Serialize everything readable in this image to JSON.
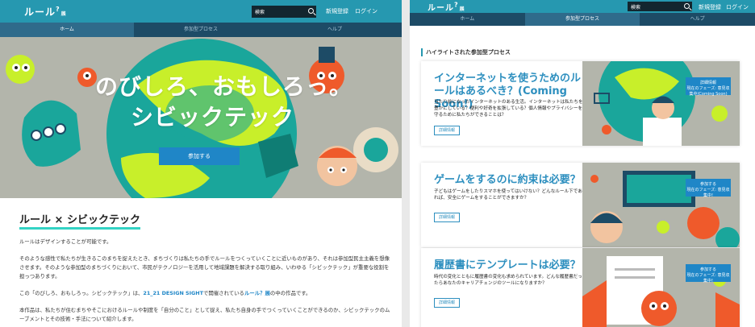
{
  "header": {
    "logo": "ルール",
    "logo_sup": "?",
    "logo_small": "展",
    "search_placeholder": "検索",
    "register": "新規登録",
    "login": "ログイン"
  },
  "nav": {
    "tabs": [
      "ホーム",
      "参加型プロセス",
      "ヘルプ"
    ]
  },
  "hero": {
    "title_line1": "のびしろ、おもしろっ。",
    "title_line2": "シビックテック",
    "cta": "参加する"
  },
  "intro": {
    "heading": "ルール × シビックテック",
    "p1": "ルールはデザインすることが可能です。",
    "p2": "そのような感性で私たちが生きるこのまちを捉えたとき、まちづくりは私たちの手でルールをつくっていくことに近いものがあり、それは参加型民主主義を想像させます。そのような参加型のまちづくりにおいて、市民がテクノロジーを活用して地域課題を解決する取り組み、いわゆる「シビックテック」が重要な役割を担っつあります。",
    "p3_a": "この「のびしろ、おもしろっ。シビックテック」は、",
    "p3_venue": "21_21 DESIGN SIGHT",
    "p3_b": "で開催されている",
    "p3_exhibit": "ルール？展",
    "p3_c": "の中の作品です。",
    "p4": "本作品は、私たちが住むまちやそこにおけるルールや制度を「自分のこと」として捉え、私たち自身の手でつくっていくことができるのか、シビックテックのムーブメントとその技術・手法について紹介します。"
  },
  "highlight": {
    "section_title": "ハイライトされた参加型プロセス",
    "cards": [
      {
        "title": "インターネットを使うためのルールはあるべき？(Coming Soon!)",
        "desc": "当たり前になったインターネットのある生活。インターネットは私たちを豊かにしている？便利や好奇を拡張している？個人情報やプライバシーを守るために私たちができることは？",
        "button": "詳細情報",
        "tag1": "詳細情報",
        "tag2": "現在のフェーズ: 意見収集中(Coming Soon)"
      },
      {
        "title": "ゲームをするのに約束は必要？",
        "desc": "子どもはゲームをしたりスマホを使ってはいけない？どんなルール下であれば、安全にゲームをすることができますか？",
        "button": "詳細情報",
        "tag1": "参加する",
        "tag2": "現在のフェーズ: 意見収集中!"
      },
      {
        "title": "履歴書にテンプレートは必要？",
        "desc": "時代の変化とともに履歴書の変化も求められています。どんな履歴書だったらあなたのキャリアチェンジのツールになりますか？",
        "button": "詳細情報",
        "tag1": "参加する",
        "tag2": "現在のフェーズ: 意見収集中!"
      }
    ]
  },
  "colors": {
    "header": "#2698b0",
    "nav": "#1d4b66",
    "accent": "#1f86c7",
    "lime": "#c8ef2a",
    "teal": "#1aa69b"
  }
}
